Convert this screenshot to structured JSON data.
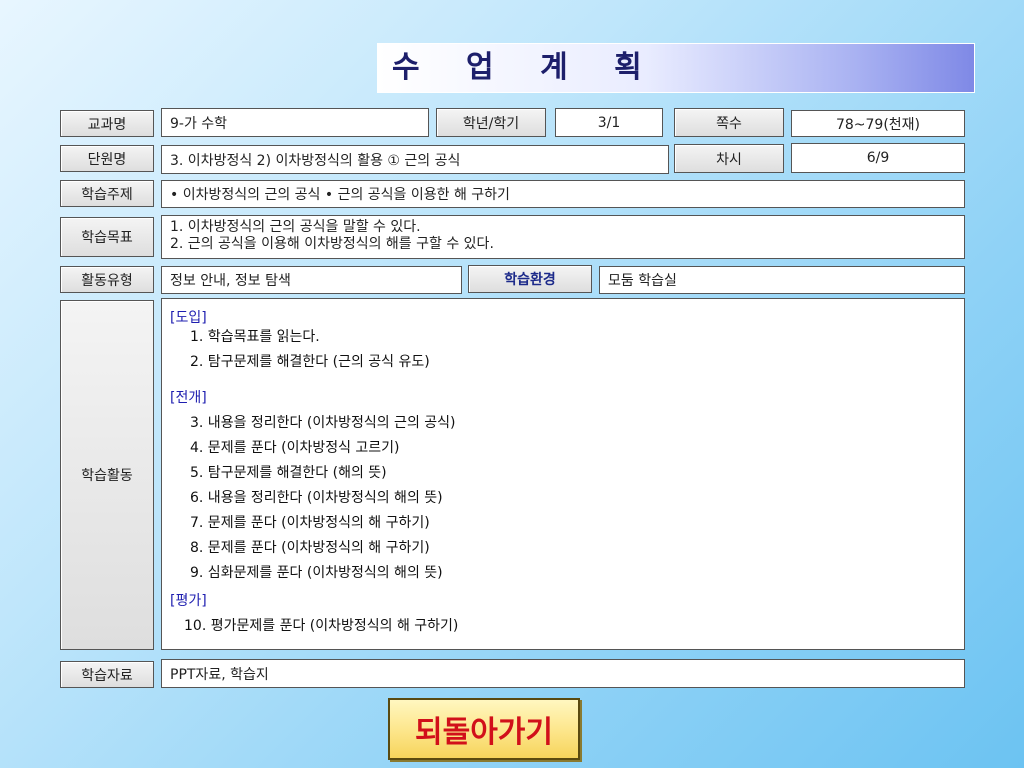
{
  "title": "수 업 계 획",
  "row1": {
    "subject_label": "교과명",
    "subject_value": "9-가  수학",
    "grade_label": "학년/학기",
    "grade_value": "3/1",
    "pages_label": "쪽수",
    "pages_value": "78~79(천재)"
  },
  "row2": {
    "unit_label": "단원명",
    "unit_value": "3. 이차방정식    2) 이차방정식의 활용  ① 근의 공식",
    "session_label": "차시",
    "session_value": "6/9"
  },
  "row3": {
    "topic_label": "학습주제",
    "topic_value": "• 이차방정식의 근의 공식          • 근의 공식을 이용한 해 구하기"
  },
  "row4": {
    "goal_label": "학습목표",
    "goals": [
      "1. 이차방정식의 근의 공식을 말할 수 있다.",
      "2. 근의 공식을 이용해 이차방정식의 해를 구할 수 있다."
    ]
  },
  "row5": {
    "type_label": "활동유형",
    "type_value": "정보 안내, 정보 탐색",
    "env_label": "학습환경",
    "env_value": "모둠 학습실"
  },
  "activity": {
    "label": "학습활동",
    "intro_head": "[도입]",
    "intro": [
      "1. 학습목표를 읽는다.",
      "2. 탐구문제를 해결한다 (근의 공식 유도)"
    ],
    "dev_head": "[전개]",
    "dev": [
      "3. 내용을 정리한다 (이차방정식의 근의 공식)",
      "4. 문제를 푼다 (이차방정식 고르기)",
      "5. 탐구문제를 해결한다 (해의 뜻)",
      "6. 내용을 정리한다 (이차방정식의 해의 뜻)",
      "7. 문제를 푼다 (이차방정식의 해 구하기)",
      "8. 문제를 푼다 (이차방정식의 해 구하기)",
      "9. 심화문제를 푼다 (이차방정식의 해의 뜻)"
    ],
    "eval_head": "[평가]",
    "eval": [
      "10. 평가문제를 푼다 (이차방정식의 해 구하기)"
    ]
  },
  "row7": {
    "material_label": "학습자료",
    "material_value": "PPT자료,  학습지"
  },
  "back_button": "되돌아가기"
}
